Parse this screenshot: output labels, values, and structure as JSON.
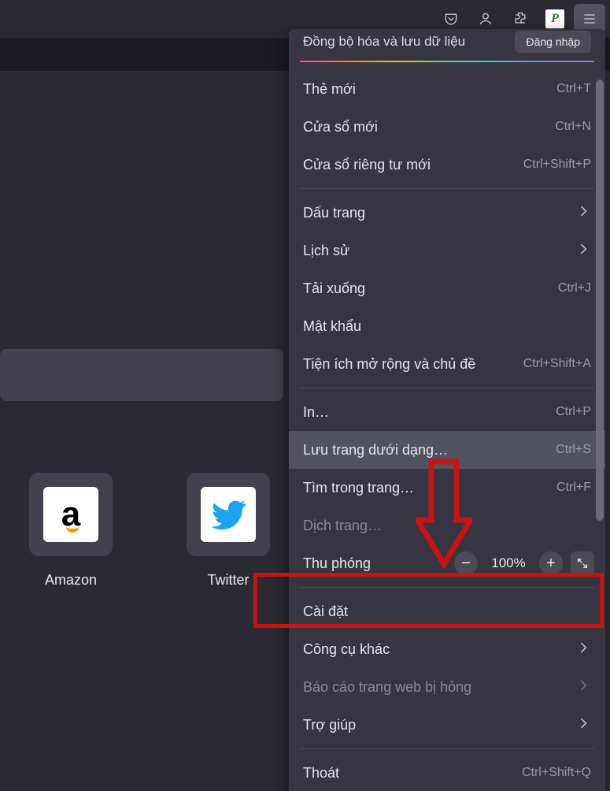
{
  "toolbar": {
    "pocket": "pocket-icon",
    "account": "account-icon",
    "extensions": "extensions-icon",
    "ext_badge": "P",
    "hamburger": "menu-icon"
  },
  "tiles": [
    {
      "label": "Amazon",
      "kind": "amazon"
    },
    {
      "label": "Twitter",
      "kind": "twitter"
    }
  ],
  "menu": {
    "sync_label": "Đồng bộ hóa và lưu dữ liệu",
    "sync_button": "Đăng nhập",
    "items_a": [
      {
        "label": "Thẻ mới",
        "shortcut": "Ctrl+T"
      },
      {
        "label": "Cửa sổ mới",
        "shortcut": "Ctrl+N"
      },
      {
        "label": "Cửa sổ riêng tư mới",
        "shortcut": "Ctrl+Shift+P"
      }
    ],
    "items_b": [
      {
        "label": "Dấu trang",
        "chevron": true
      },
      {
        "label": "Lịch sử",
        "chevron": true
      },
      {
        "label": "Tải xuống",
        "shortcut": "Ctrl+J"
      },
      {
        "label": "Mật khẩu"
      },
      {
        "label": "Tiện ích mở rộng và chủ đề",
        "shortcut": "Ctrl+Shift+A"
      }
    ],
    "items_c": [
      {
        "label": "In…",
        "shortcut": "Ctrl+P"
      },
      {
        "label": "Lưu trang dưới dạng…",
        "shortcut": "Ctrl+S",
        "hover": true
      },
      {
        "label": "Tìm trong trang…",
        "shortcut": "Ctrl+F"
      },
      {
        "label": "Dịch trang…",
        "disabled": true
      }
    ],
    "zoom": {
      "label": "Thu phóng",
      "value": "100%"
    },
    "items_d": [
      {
        "label": "Cài đặt"
      },
      {
        "label": "Công cụ khác",
        "chevron": true
      },
      {
        "label": "Báo cáo trang web bị hỏng",
        "chevron": true,
        "disabled": true
      },
      {
        "label": "Trợ giúp",
        "chevron": true
      }
    ],
    "items_e": [
      {
        "label": "Thoát",
        "shortcut": "Ctrl+Shift+Q"
      }
    ]
  }
}
